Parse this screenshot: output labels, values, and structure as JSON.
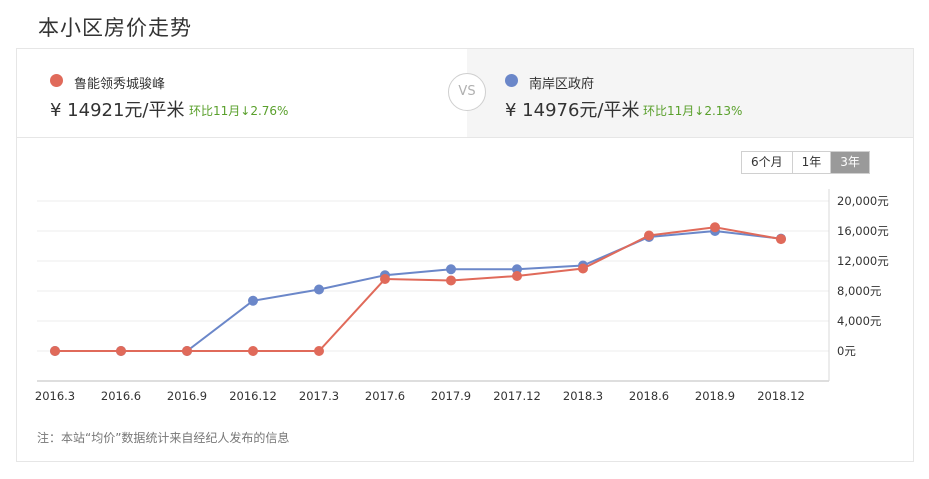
{
  "page": {
    "title": "本小区房价走势"
  },
  "compare": {
    "left": {
      "name": "鲁能领秀城骏峰",
      "price": "¥ 14921元/平米",
      "change": "环比11月↓2.76%",
      "color": "#e06a5a"
    },
    "vs_label": "VS",
    "right": {
      "name": "南岸区政府",
      "price": "¥ 14976元/平米",
      "change": "环比11月↓2.13%",
      "color": "#6b87c9"
    }
  },
  "range_tabs": [
    {
      "label": "6个月",
      "active": false
    },
    {
      "label": "1年",
      "active": false
    },
    {
      "label": "3年",
      "active": true
    }
  ],
  "note": "注：本站“均价”数据统计来自经纪人发布的信息",
  "chart_data": {
    "type": "line",
    "categories": [
      "2016.3",
      "2016.6",
      "2016.9",
      "2016.12",
      "2017.3",
      "2017.6",
      "2017.9",
      "2017.12",
      "2018.3",
      "2018.6",
      "2018.9",
      "2018.12"
    ],
    "yticks": [
      "20,000元",
      "16,000元",
      "12,000元",
      "8,000元",
      "4,000元",
      "0元"
    ],
    "ylim": [
      0,
      20000
    ],
    "grid": true,
    "series": [
      {
        "name": "鲁能领秀城骏峰",
        "color": "#e06a5a",
        "values": [
          0,
          0,
          0,
          0,
          0,
          9600,
          9400,
          10000,
          11000,
          15400,
          16500,
          14921
        ]
      },
      {
        "name": "南岸区政府",
        "color": "#6b87c9",
        "values": [
          0,
          0,
          0,
          6700,
          8200,
          10100,
          10900,
          10900,
          11400,
          15200,
          16000,
          14976
        ]
      }
    ]
  }
}
